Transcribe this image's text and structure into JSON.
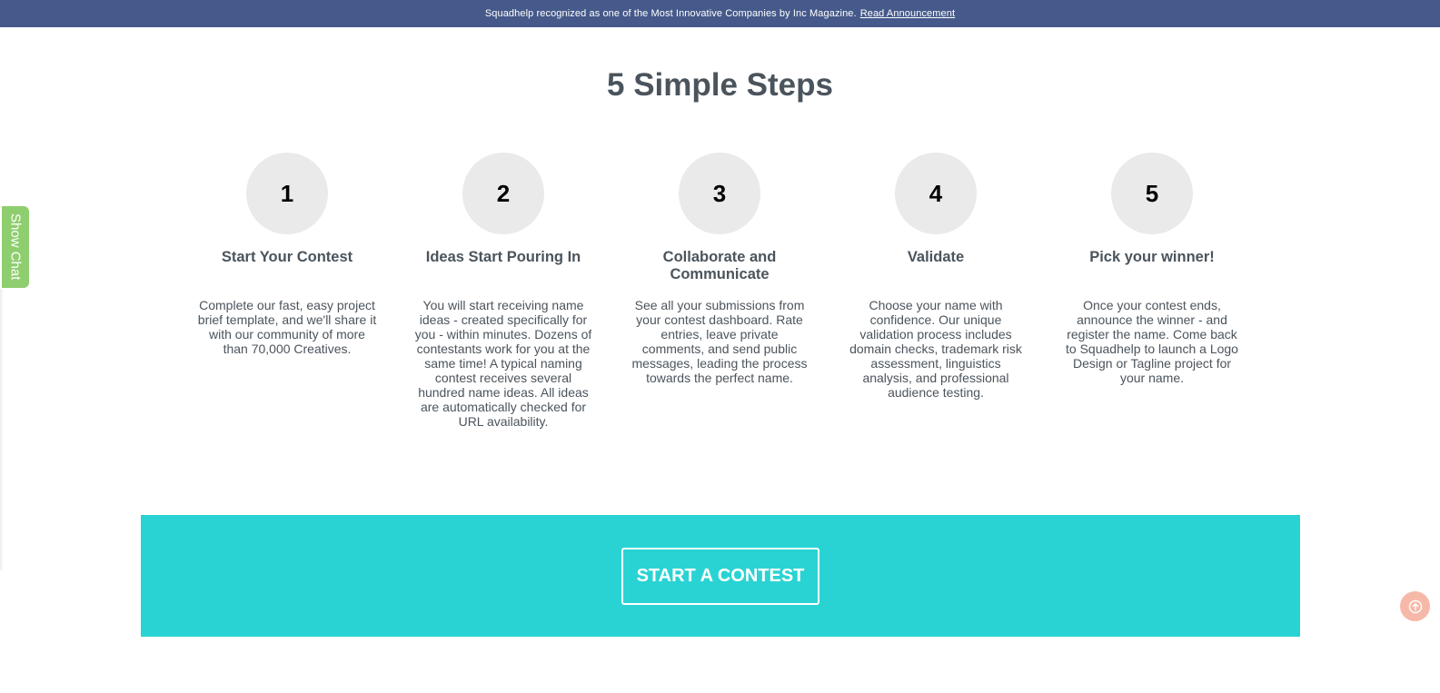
{
  "announcement": {
    "text": "Squadhelp recognized as one of the Most Innovative Companies by Inc Magazine.",
    "link_label": "Read Announcement"
  },
  "title": "5 Simple Steps",
  "steps": [
    {
      "number": "1",
      "title": "Start Your Contest",
      "description": "Complete our fast, easy project brief template, and we'll share it with our community of more than 70,000 Creatives."
    },
    {
      "number": "2",
      "title": "Ideas Start Pouring In",
      "description": "You will start receiving name ideas - created specifically for you - within minutes. Dozens of contestants work for you at the same time! A typical naming contest receives several hundred name ideas. All ideas are automatically checked for URL availability."
    },
    {
      "number": "3",
      "title": "Collaborate and Communicate",
      "description": "See all your submissions from your contest dashboard. Rate entries, leave private comments, and send public messages, leading the process towards the perfect name."
    },
    {
      "number": "4",
      "title": "Validate",
      "description": "Choose your name with confidence. Our unique validation process includes domain checks, trademark risk assessment, linguistics analysis, and professional audience testing."
    },
    {
      "number": "5",
      "title": "Pick your winner!",
      "description": "Once your contest ends, announce the winner - and register the name. Come back to Squadhelp to launch a Logo Design or Tagline project for your name."
    }
  ],
  "cta": {
    "label": "START A CONTEST"
  },
  "chat": {
    "label": "Show Chat"
  },
  "icons": {
    "scroll_top": "arrow-up-circle-icon"
  },
  "colors": {
    "announcement_bg": "#45598a",
    "cta_bg": "#2ad3d3",
    "chat_bg": "#8fce6f",
    "scroll_top_bg": "#f6b8a8",
    "step_circle_bg": "#eaeaea",
    "text": "#4b545c"
  }
}
